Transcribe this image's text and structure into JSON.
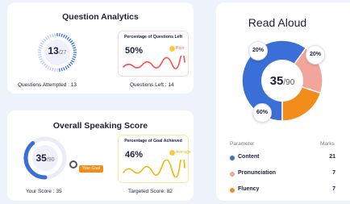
{
  "question_analytics": {
    "title": "Question Analytics",
    "ring_value": "13",
    "ring_total": "/27",
    "attempted_fraction": 0.48,
    "questions_left_card": {
      "title": "Percentage of Questions Left",
      "value": "50%",
      "status": "Poor",
      "status_color": "#ff6b6b",
      "line_color": "#ff4d4d"
    },
    "attempted_label": "Questions Attempted : 13",
    "left_label": "Questions Left : 14"
  },
  "speaking_score": {
    "title": "Overall Speaking Score",
    "score_value": "35",
    "score_total": "/90",
    "score_fraction": 0.39,
    "goal_badge": "Your Goal",
    "goal_card": {
      "title": "Percentage of Goal Achieved",
      "value": "46%",
      "status": "Average",
      "status_color": "#f2b705",
      "line_color": "#f2b705"
    },
    "your_score_label": "Your Score : 35",
    "target_score_label": "Targeted Score: 82"
  },
  "read_aloud": {
    "title": "Read Aloud",
    "center_value": "35",
    "center_total": "/90",
    "segments": [
      {
        "name": "Content",
        "percent_label": "60%",
        "fraction": 0.6,
        "color": "#3a6fd8"
      },
      {
        "name": "Pronunciation",
        "percent_label": "20%",
        "fraction": 0.2,
        "color": "#f2a59a"
      },
      {
        "name": "Fluency",
        "percent_label": "20%",
        "fraction": 0.2,
        "color": "#f28c1b"
      }
    ],
    "table_headers": {
      "parameter": "Parameter",
      "marks": "Marks"
    },
    "rows": [
      {
        "label": "Content",
        "mark": "21",
        "color": "#3a6fd8"
      },
      {
        "label": "Pronunciation",
        "mark": "7",
        "color": "#f2a59a"
      },
      {
        "label": "Fluency",
        "mark": "7",
        "color": "#f28c1b"
      }
    ]
  }
}
